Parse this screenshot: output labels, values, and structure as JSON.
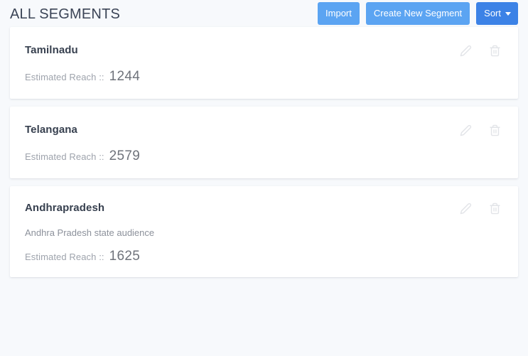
{
  "header": {
    "title": "ALL SEGMENTS",
    "buttons": [
      {
        "label": "Import",
        "name": "import-button",
        "style": "light"
      },
      {
        "label": "Create New Segment",
        "name": "create-new-segment-button",
        "style": "light"
      },
      {
        "label": "Sort",
        "name": "sort-button",
        "style": "dark",
        "caret": true
      }
    ]
  },
  "icons": {
    "edit": "pencil-icon",
    "delete": "trash-icon",
    "caret": "caret-down-icon"
  },
  "colors": {
    "page_background": "#f7f9fc",
    "card_background": "#ffffff",
    "button_light_blue": "#5ba4f2",
    "button_dark_blue": "#3c82e6",
    "title_text": "#3b4456",
    "segment_name_text": "#37404f",
    "reach_label_text": "#9ea3ac",
    "reach_value_text": "#6f737b",
    "icon_grey": "#e2e4e8"
  },
  "labels": {
    "reach_prefix": "Estimated Reach ::"
  },
  "segments": [
    {
      "name": "Tamilnadu",
      "description": null,
      "reach_label": "Estimated Reach ::",
      "reach_value": "1244"
    },
    {
      "name": "Telangana",
      "description": null,
      "reach_label": "Estimated Reach ::",
      "reach_value": "2579"
    },
    {
      "name": "Andhrapradesh",
      "description": "Andhra Pradesh state audience",
      "reach_label": "Estimated Reach ::",
      "reach_value": "1625"
    }
  ]
}
